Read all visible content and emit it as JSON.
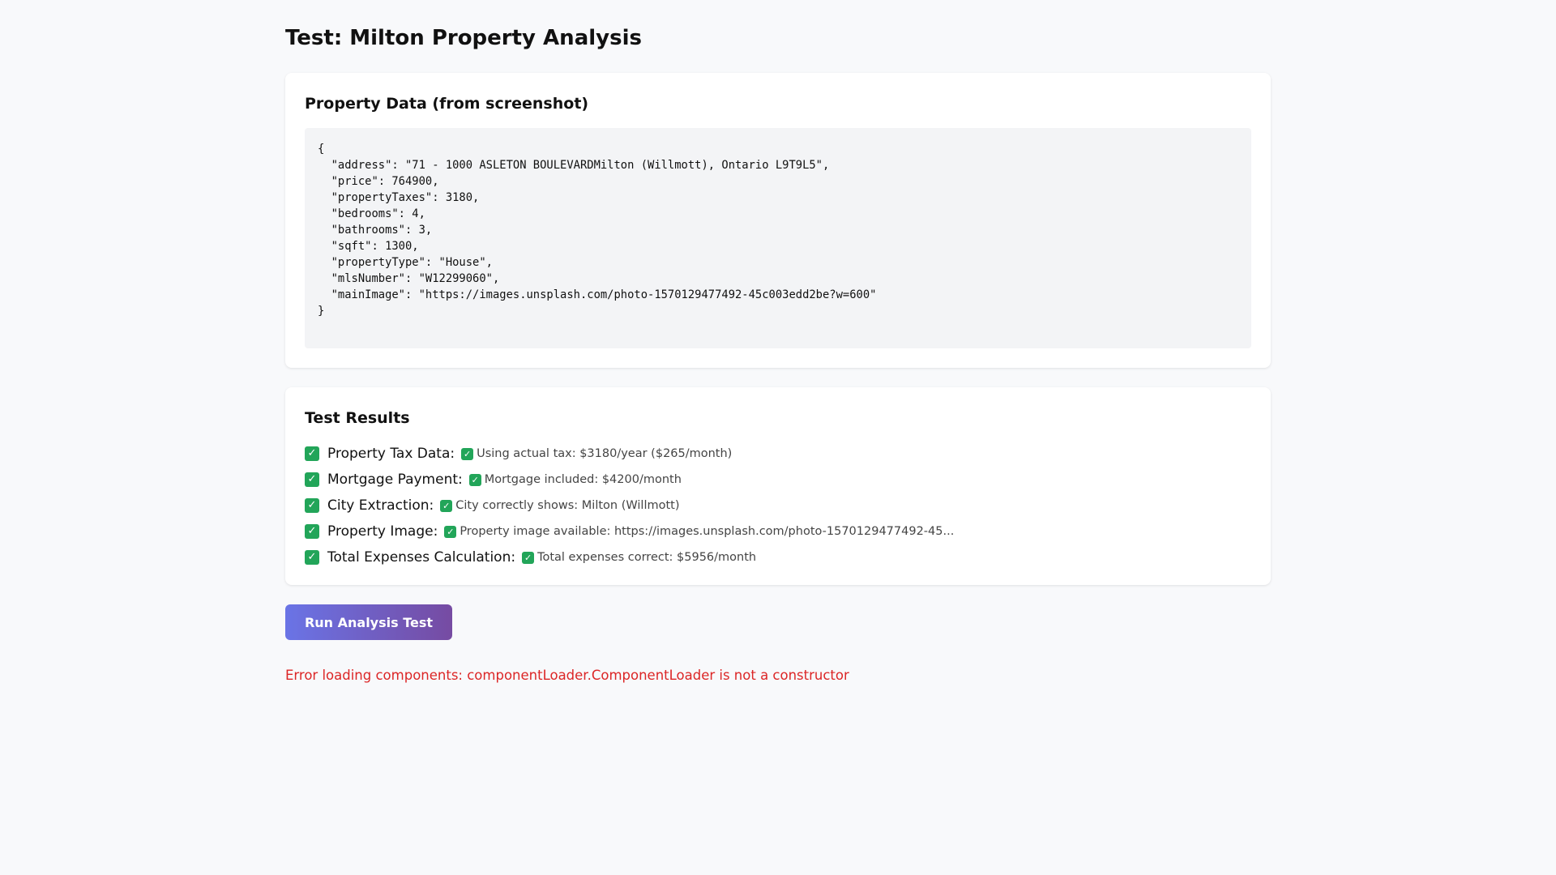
{
  "page": {
    "title": "Test: Milton Property Analysis"
  },
  "property_card": {
    "heading": "Property Data (from screenshot)",
    "code": "{\n  \"address\": \"71 - 1000 ASLETON BOULEVARDMilton (Willmott), Ontario L9T9L5\",\n  \"price\": 764900,\n  \"propertyTaxes\": 3180,\n  \"bedrooms\": 4,\n  \"bathrooms\": 3,\n  \"sqft\": 1300,\n  \"propertyType\": \"House\",\n  \"mlsNumber\": \"W12299060\",\n  \"mainImage\": \"https://images.unsplash.com/photo-1570129477492-45c003edd2be?w=600\"\n}"
  },
  "results_card": {
    "heading": "Test Results",
    "items": [
      {
        "label": "Property Tax Data:",
        "value": "Using actual tax: $3180/year ($265/month)"
      },
      {
        "label": "Mortgage Payment:",
        "value": "Mortgage included: $4200/month"
      },
      {
        "label": "City Extraction:",
        "value": "City correctly shows: Milton (Willmott)"
      },
      {
        "label": "Property Image:",
        "value": "Property image available: https://images.unsplash.com/photo-1570129477492-45..."
      },
      {
        "label": "Total Expenses Calculation:",
        "value": "Total expenses correct: $5956/month"
      }
    ]
  },
  "actions": {
    "run_label": "Run Analysis Test"
  },
  "error": {
    "message": "Error loading components: componentLoader.ComponentLoader is not a constructor"
  },
  "icons": {
    "check": "check-mark-icon"
  },
  "colors": {
    "check": "#22a559",
    "error": "#dc2626",
    "button_start": "#6a74e6",
    "button_end": "#764ba2"
  }
}
